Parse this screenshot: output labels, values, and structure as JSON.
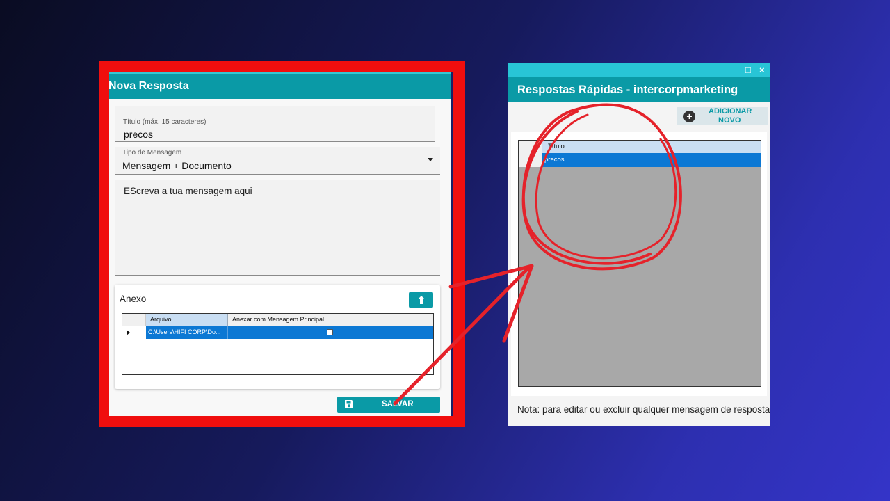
{
  "nova_resposta": {
    "title": "Nova Resposta",
    "titulo_field": {
      "label": "Título (máx. 15 caracteres)",
      "value": "precos"
    },
    "tipo_field": {
      "label": "Tipo de Mensagem",
      "value": "Mensagem + Documento"
    },
    "mensagem_field": {
      "value": "EScreva a tua mensagem aqui"
    },
    "anexo": {
      "title": "Anexo",
      "columns": [
        "Arquivo",
        "Anexar com Mensagem Principal"
      ],
      "rows": [
        {
          "arquivo": "C:\\Users\\HIFI CORP\\Do...",
          "anexar": false
        }
      ]
    },
    "save_label": "SALVAR"
  },
  "respostas_rapidas": {
    "title": "Respostas Rápidas - intercorpmarketing",
    "window_controls": [
      "_",
      "□",
      "×"
    ],
    "add_label_line1": "ADICIONAR",
    "add_label_line2": "NOVO",
    "grid": {
      "columns": [
        "Título"
      ],
      "rows": [
        "precos"
      ]
    },
    "note": "Nota: para editar ou excluir qualquer mensagem de resposta"
  },
  "colors": {
    "teal": "#0a9aa6",
    "highlight_red": "#f00e0e",
    "selection_blue": "#0c78d4"
  },
  "icons": [
    "upload-arrow-icon",
    "save-disk-icon",
    "plus-circle-icon",
    "dropdown-caret-icon",
    "row-pointer-icon"
  ]
}
